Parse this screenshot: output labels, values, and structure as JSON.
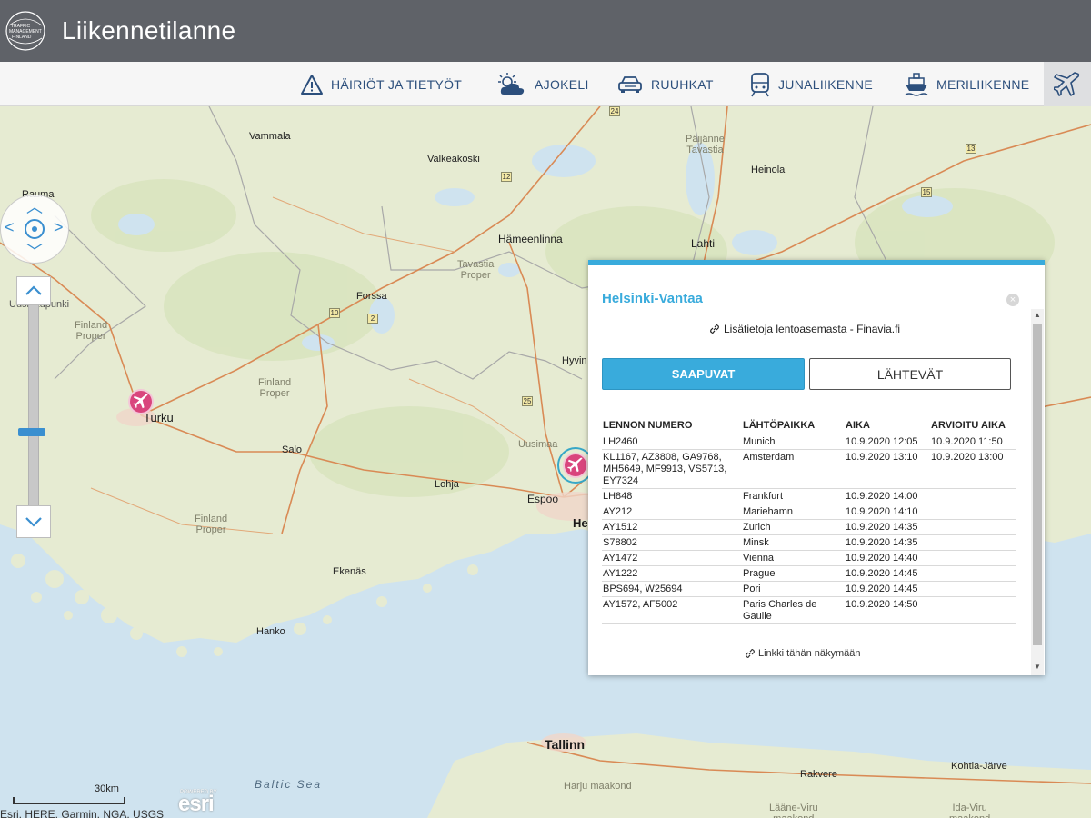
{
  "header": {
    "title": "Liikennetilanne",
    "logo_text": [
      "TRAFFIC",
      "MANAGEMENT",
      "FINLAND"
    ]
  },
  "nav": {
    "items": [
      {
        "label": "HÄIRIÖT JA TIETYÖT",
        "icon": "warning-icon"
      },
      {
        "label": "AJOKELI",
        "icon": "weather-icon"
      },
      {
        "label": "RUUHKAT",
        "icon": "car-icon"
      },
      {
        "label": "JUNALIIKENNE",
        "icon": "train-icon"
      },
      {
        "label": "MERILIIKENNE",
        "icon": "ship-icon"
      }
    ],
    "active_icon": "airplane-icon"
  },
  "map": {
    "places": {
      "vammala": "Vammala",
      "valkeakoski": "Valkeakoski",
      "paijanne": "Päijänne\nTavastia",
      "heinola": "Heinola",
      "rauma": "Rauma",
      "hameenlinna": "Hämeenlinna",
      "lahti": "Lahti",
      "tavastia": "Tavastia\nProper",
      "uusikaupunki": "Uusikaupunki",
      "forssa": "Forssa",
      "finland_proper_1": "Finland\nProper",
      "hyvinkaa": "Hyvin",
      "finland_proper_2": "Finland\nProper",
      "turku": "Turku",
      "uusimaa": "Uusimaa",
      "salo": "Salo",
      "lohja": "Lohja",
      "espoo": "Espoo",
      "helsinki": "He",
      "finland_proper_3": "Finland\nProper",
      "ekenas": "Ekenäs",
      "hanko": "Hanko",
      "tallinn": "Tallinn",
      "rakvere": "Rakvere",
      "kohtla": "Kohtla-Järve",
      "harju": "Harju maakond",
      "laane": "Lääne-Viru\nmaakond",
      "ida": "Ida-Viru\nmaakond",
      "baltic": "Baltic Sea"
    },
    "roads": [
      "24",
      "13",
      "12",
      "15",
      "10",
      "2",
      "25"
    ],
    "scale_label": "30km",
    "attribution": "Esri, HERE, Garmin, NGA, USGS",
    "esri_powered": "POWERED BY",
    "esri_logo": "esri"
  },
  "popup": {
    "title": "Helsinki-Vantaa",
    "info_link": "Lisätietoja lentoasemasta - Finavia.fi",
    "tab_arrivals": "SAAPUVAT",
    "tab_departures": "LÄHTEVÄT",
    "columns": [
      "LENNON NUMERO",
      "LÄHTÖPAIKKA",
      "AIKA",
      "ARVIOITU AIKA"
    ],
    "flights": [
      {
        "number": "LH2460",
        "origin": "Munich",
        "time": "10.9.2020 12:05",
        "estimated": "10.9.2020 11:50"
      },
      {
        "number": "KL1167, AZ3808, GA9768, MH5649, MF9913, VS5713, EY7324",
        "origin": "Amsterdam",
        "time": "10.9.2020 13:10",
        "estimated": "10.9.2020 13:00"
      },
      {
        "number": "LH848",
        "origin": "Frankfurt",
        "time": "10.9.2020 14:00",
        "estimated": ""
      },
      {
        "number": "AY212",
        "origin": "Mariehamn",
        "time": "10.9.2020 14:10",
        "estimated": ""
      },
      {
        "number": "AY1512",
        "origin": "Zurich",
        "time": "10.9.2020 14:35",
        "estimated": ""
      },
      {
        "number": "S78802",
        "origin": "Minsk",
        "time": "10.9.2020 14:35",
        "estimated": ""
      },
      {
        "number": "AY1472",
        "origin": "Vienna",
        "time": "10.9.2020 14:40",
        "estimated": ""
      },
      {
        "number": "AY1222",
        "origin": "Prague",
        "time": "10.9.2020 14:45",
        "estimated": ""
      },
      {
        "number": "BPS694, W25694",
        "origin": "Pori",
        "time": "10.9.2020 14:45",
        "estimated": ""
      },
      {
        "number": "AY1572, AF5002",
        "origin": "Paris Charles de Gaulle",
        "time": "10.9.2020 14:50",
        "estimated": ""
      }
    ],
    "view_link": "Linkki tähän näkymään"
  },
  "colors": {
    "header_bg": "#5f6268",
    "accent": "#39abdc",
    "nav_text": "#2c4f7c",
    "marker": "#d9457d"
  }
}
